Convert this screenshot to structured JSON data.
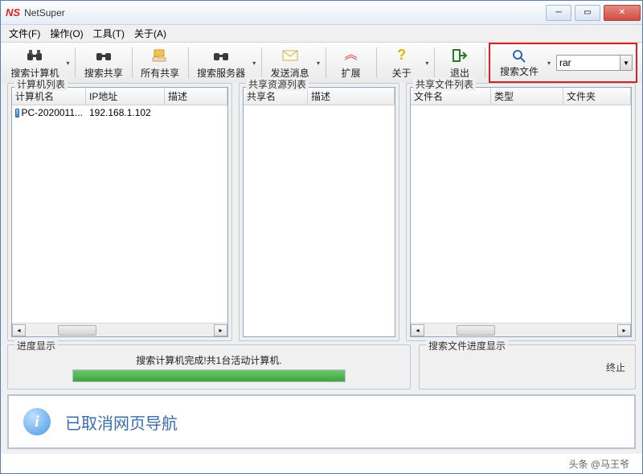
{
  "window": {
    "title": "NetSuper"
  },
  "menu": {
    "file": "文件(F)",
    "operate": "操作(O)",
    "tool": "工具(T)",
    "about": "关于(A)"
  },
  "toolbar": {
    "search_pc": "搜索计算机",
    "search_share": "搜索共享",
    "all_shares": "所有共享",
    "search_server": "搜索服务器",
    "send_msg": "发送消息",
    "expand": "扩展",
    "about": "关于",
    "exit": "退出",
    "search_file": "搜索文件"
  },
  "search": {
    "value": "rar"
  },
  "panels": {
    "left": {
      "legend": "计算机列表",
      "cols": {
        "name": "计算机名",
        "ip": "IP地址",
        "desc": "描述"
      },
      "rows": [
        {
          "name": "PC-2020011...",
          "ip": "192.168.1.102",
          "desc": ""
        }
      ]
    },
    "mid": {
      "legend": "共享资源列表",
      "cols": {
        "name": "共享名",
        "desc": "描述"
      }
    },
    "right": {
      "legend": "共享文件列表",
      "cols": {
        "name": "文件名",
        "type": "类型",
        "folder": "文件夹"
      }
    }
  },
  "progress": {
    "left_legend": "进度显示",
    "text": "搜索计算机完成!共1台活动计算机.",
    "right_legend": "搜索文件进度显示",
    "stop": "终止"
  },
  "info": {
    "msg": "已取消网页导航"
  },
  "footer": {
    "credit": "头条 @马王爷"
  }
}
